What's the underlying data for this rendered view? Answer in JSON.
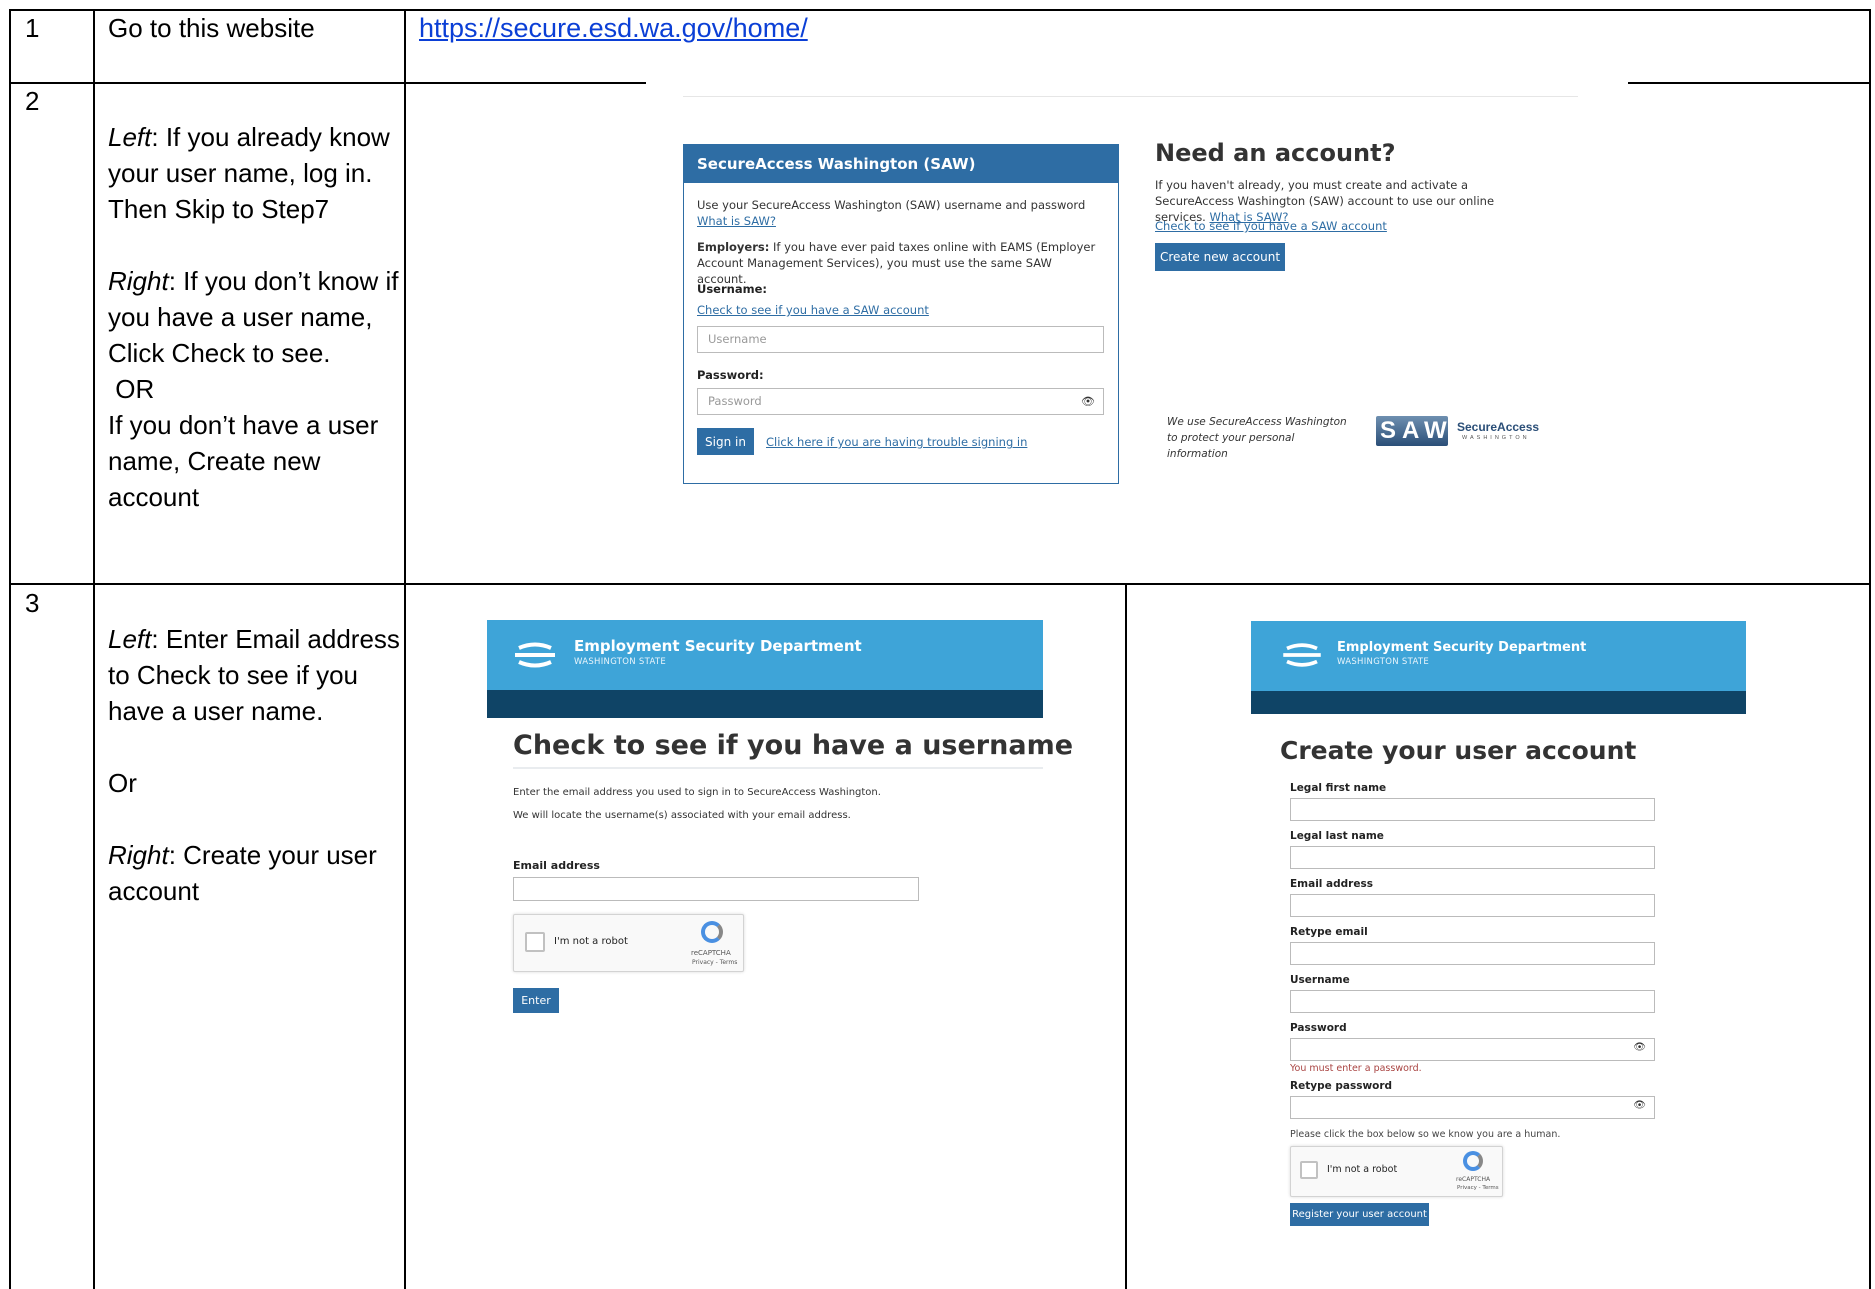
{
  "rows": [
    {
      "num": "1",
      "instruction": "Go to this website",
      "url": "https://secure.esd.wa.gov/home/"
    },
    {
      "num": "2",
      "left_label": "Left",
      "left_text": ": If you already know your user name, log in. Then Skip to Step7",
      "right_label": "Right",
      "right_text": ": If you don’t know if you have a user name, Click Check to see.",
      "or": " OR",
      "no_user_text": "If you don’t have a user name, Create new account"
    },
    {
      "num": "3",
      "left_label": "Left",
      "left_text": ": Enter Email address to Check to see if you have a user name.",
      "or": "Or",
      "right_label": "Right",
      "right_text": ": Create your user account"
    }
  ],
  "saw_login": {
    "panel_title": "SecureAccess Washington (SAW)",
    "intro": "Use your SecureAccess Washington (SAW) username and password",
    "what_is_saw": "What is SAW?",
    "employers_bold": "Employers:",
    "employers_text": " If you have ever paid taxes online with EAMS (Employer Account Management Services), you must use the same SAW account.",
    "username_label": "Username:",
    "check_link": "Check to see if you have a SAW account",
    "username_placeholder": "Username",
    "password_label": "Password:",
    "password_placeholder": "Password",
    "sign_in": "Sign in",
    "trouble_link": "Click here if you are having trouble signing in"
  },
  "saw_need_account": {
    "title": "Need an account?",
    "text": "If you haven't already, you must create and activate a SecureAccess Washington (SAW) account to use our online services.",
    "what_is_saw": "What is SAW?",
    "check_link": "Check to see if you have a SAW account",
    "create_button": "Create new account",
    "protect_text": "We use SecureAccess Washington to protect your personal information",
    "logo_letters": "SAW",
    "logo_brand": "SecureAccess",
    "logo_sub": "WASHINGTON"
  },
  "check_username": {
    "dept_title": "Employment Security Department",
    "dept_sub": "WASHINGTON STATE",
    "heading": "Check to see if you have a username",
    "line1": "Enter the email address you used to sign in to SecureAccess Washington.",
    "line2": "We will locate the username(s) associated with your email address.",
    "email_label": "Email address",
    "robot_label": "I'm not a robot",
    "recaptcha": "reCAPTCHA",
    "privacy": "Privacy - Terms",
    "enter_button": "Enter"
  },
  "create_account": {
    "dept_title": "Employment Security Department",
    "dept_sub": "WASHINGTON STATE",
    "heading": "Create your user account",
    "fields": [
      "Legal first name",
      "Legal last name",
      "Email address",
      "Retype email",
      "Username",
      "Password",
      "Retype password"
    ],
    "password_error": "You must enter a password.",
    "human_text": "Please click the box below so we know you are a human.",
    "robot_label": "I'm not a robot",
    "recaptcha": "reCAPTCHA",
    "privacy": "Privacy - Terms",
    "register_button": "Register your user account"
  },
  "colors": {
    "link": "#0b3fd6",
    "saw_blue": "#2e6da4",
    "esd_light": "#3ea4d8",
    "esd_dark": "#0f4466",
    "error": "#a94442"
  },
  "icons": [
    "eye-icon",
    "esd-logo-icon",
    "recaptcha-icon",
    "saw-logo"
  ]
}
